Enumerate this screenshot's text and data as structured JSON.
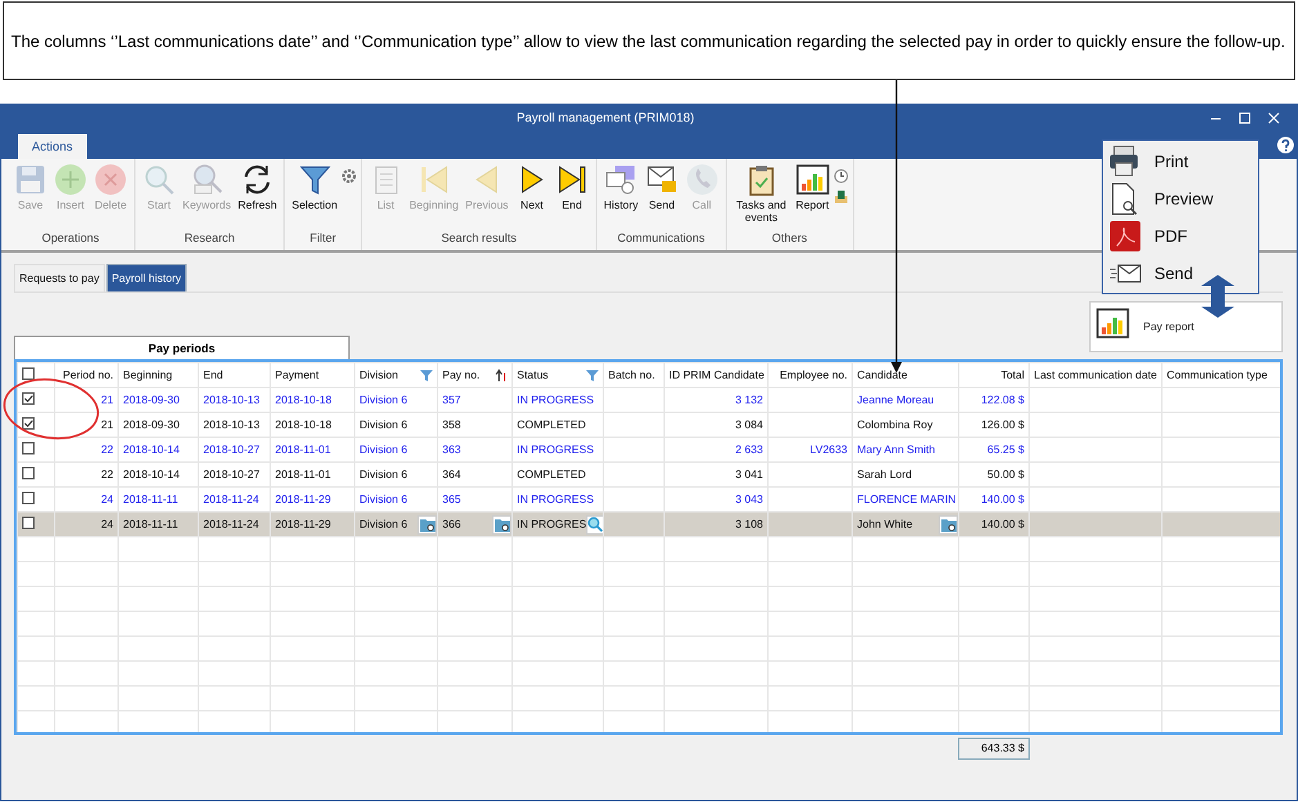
{
  "callout": {
    "text": "The columns ‘’Last communications date’’ and ‘’Communication type’’ allow to view the last communication regarding the selected pay in order to quickly ensure the follow-up."
  },
  "window": {
    "title": "Payroll management (PRIM018)"
  },
  "ribbon_tab": {
    "label": "Actions",
    "selected": true
  },
  "ribbon_groups": [
    {
      "label": "Operations",
      "buttons": [
        {
          "label": "Save",
          "disabled": true
        },
        {
          "label": "Insert",
          "disabled": true
        },
        {
          "label": "Delete",
          "disabled": true
        }
      ]
    },
    {
      "label": "Research",
      "buttons": [
        {
          "label": "Start",
          "disabled": true
        },
        {
          "label": "Keywords",
          "disabled": true
        },
        {
          "label": "Refresh",
          "disabled": false
        }
      ]
    },
    {
      "label": "Filter",
      "buttons": [
        {
          "label": "Selection",
          "disabled": false
        }
      ]
    },
    {
      "label": "Search results",
      "buttons": [
        {
          "label": "List",
          "disabled": true
        },
        {
          "label": "Beginning",
          "disabled": true
        },
        {
          "label": "Previous",
          "disabled": true
        },
        {
          "label": "Next",
          "disabled": false
        },
        {
          "label": "End",
          "disabled": false
        }
      ]
    },
    {
      "label": "Communications",
      "buttons": [
        {
          "label": "History",
          "disabled": false
        },
        {
          "label": "Send",
          "disabled": false
        },
        {
          "label": "Call",
          "disabled": true
        }
      ]
    },
    {
      "label": "Others",
      "buttons": [
        {
          "label": "Tasks and events",
          "disabled": false
        },
        {
          "label": "Report",
          "disabled": false
        }
      ]
    }
  ],
  "report_menu": [
    {
      "label": "Print"
    },
    {
      "label": "Preview"
    },
    {
      "label": "PDF"
    },
    {
      "label": "Send"
    }
  ],
  "tabs": [
    {
      "label": "Requests to pay",
      "selected": false
    },
    {
      "label": "Payroll history",
      "selected": true
    }
  ],
  "pay_report": {
    "label": "Pay report"
  },
  "grid": {
    "band": "Pay periods",
    "select_all": {
      "checked": false
    },
    "columns": [
      {
        "label": "Period no.",
        "filtered": false,
        "sorted": false
      },
      {
        "label": "Beginning",
        "filtered": false,
        "sorted": false
      },
      {
        "label": "End",
        "filtered": false,
        "sorted": false
      },
      {
        "label": "Payment",
        "filtered": false,
        "sorted": false
      },
      {
        "label": "Division",
        "filtered": true,
        "sorted": false
      },
      {
        "label": "Pay no.",
        "filtered": false,
        "sorted": true
      },
      {
        "label": "Status",
        "filtered": true,
        "sorted": false
      },
      {
        "label": "Batch no.",
        "filtered": false,
        "sorted": false
      },
      {
        "label": "ID PRIM Candidate",
        "filtered": false,
        "sorted": false
      },
      {
        "label": "Employee no.",
        "filtered": false,
        "sorted": false
      },
      {
        "label": "Candidate",
        "filtered": false,
        "sorted": false
      },
      {
        "label": "Total",
        "filtered": false,
        "sorted": false
      },
      {
        "label": "Last communication date",
        "filtered": false,
        "sorted": false
      },
      {
        "label": "Communication type",
        "filtered": false,
        "sorted": false
      }
    ],
    "rows": [
      {
        "checked": true,
        "selected": false,
        "emphasized": true,
        "cells": [
          "21",
          "2018-09-30",
          "2018-10-13",
          "2018-10-18",
          "Division 6",
          "357",
          "IN PROGRESS",
          null,
          "3 132",
          null,
          "Jeanne Moreau",
          "122.08 $",
          null,
          null
        ]
      },
      {
        "checked": true,
        "selected": false,
        "emphasized": false,
        "cells": [
          "21",
          "2018-09-30",
          "2018-10-13",
          "2018-10-18",
          "Division 6",
          "358",
          "COMPLETED",
          null,
          "3 084",
          null,
          "Colombina Roy",
          "126.00 $",
          null,
          null
        ]
      },
      {
        "checked": false,
        "selected": false,
        "emphasized": true,
        "cells": [
          "22",
          "2018-10-14",
          "2018-10-27",
          "2018-11-01",
          "Division 6",
          "363",
          "IN PROGRESS",
          null,
          "2 633",
          "LV2633",
          "Mary Ann Smith",
          "65.25 $",
          null,
          null
        ]
      },
      {
        "checked": false,
        "selected": false,
        "emphasized": false,
        "cells": [
          "22",
          "2018-10-14",
          "2018-10-27",
          "2018-11-01",
          "Division 6",
          "364",
          "COMPLETED",
          null,
          "3 041",
          null,
          "Sarah Lord",
          "50.00 $",
          null,
          null
        ]
      },
      {
        "checked": false,
        "selected": false,
        "emphasized": true,
        "cells": [
          "24",
          "2018-11-11",
          "2018-11-24",
          "2018-11-29",
          "Division 6",
          "365",
          "IN PROGRESS",
          null,
          "3 043",
          null,
          "FLORENCE MARIN",
          "140.00 $",
          null,
          null
        ]
      },
      {
        "checked": false,
        "selected": true,
        "emphasized": false,
        "cells": [
          "24",
          "2018-11-11",
          "2018-11-24",
          "2018-11-29",
          "Division 6",
          "366",
          "IN PROGRES",
          null,
          "3 108",
          null,
          "John White",
          "140.00 $",
          null,
          null
        ]
      }
    ],
    "sum": "643.33 $"
  }
}
